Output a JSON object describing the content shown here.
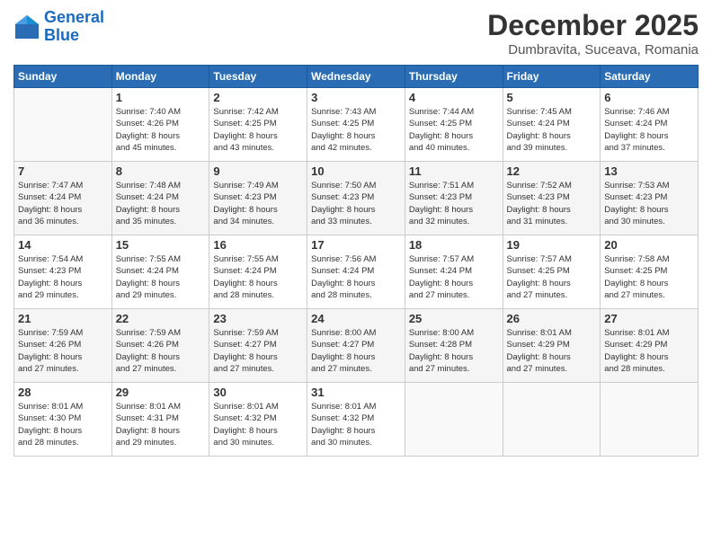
{
  "header": {
    "logo_line1": "General",
    "logo_line2": "Blue",
    "month": "December 2025",
    "location": "Dumbravita, Suceava, Romania"
  },
  "weekdays": [
    "Sunday",
    "Monday",
    "Tuesday",
    "Wednesday",
    "Thursday",
    "Friday",
    "Saturday"
  ],
  "weeks": [
    [
      {
        "day": "",
        "info": ""
      },
      {
        "day": "1",
        "info": "Sunrise: 7:40 AM\nSunset: 4:26 PM\nDaylight: 8 hours\nand 45 minutes."
      },
      {
        "day": "2",
        "info": "Sunrise: 7:42 AM\nSunset: 4:25 PM\nDaylight: 8 hours\nand 43 minutes."
      },
      {
        "day": "3",
        "info": "Sunrise: 7:43 AM\nSunset: 4:25 PM\nDaylight: 8 hours\nand 42 minutes."
      },
      {
        "day": "4",
        "info": "Sunrise: 7:44 AM\nSunset: 4:25 PM\nDaylight: 8 hours\nand 40 minutes."
      },
      {
        "day": "5",
        "info": "Sunrise: 7:45 AM\nSunset: 4:24 PM\nDaylight: 8 hours\nand 39 minutes."
      },
      {
        "day": "6",
        "info": "Sunrise: 7:46 AM\nSunset: 4:24 PM\nDaylight: 8 hours\nand 37 minutes."
      }
    ],
    [
      {
        "day": "7",
        "info": "Sunrise: 7:47 AM\nSunset: 4:24 PM\nDaylight: 8 hours\nand 36 minutes."
      },
      {
        "day": "8",
        "info": "Sunrise: 7:48 AM\nSunset: 4:24 PM\nDaylight: 8 hours\nand 35 minutes."
      },
      {
        "day": "9",
        "info": "Sunrise: 7:49 AM\nSunset: 4:23 PM\nDaylight: 8 hours\nand 34 minutes."
      },
      {
        "day": "10",
        "info": "Sunrise: 7:50 AM\nSunset: 4:23 PM\nDaylight: 8 hours\nand 33 minutes."
      },
      {
        "day": "11",
        "info": "Sunrise: 7:51 AM\nSunset: 4:23 PM\nDaylight: 8 hours\nand 32 minutes."
      },
      {
        "day": "12",
        "info": "Sunrise: 7:52 AM\nSunset: 4:23 PM\nDaylight: 8 hours\nand 31 minutes."
      },
      {
        "day": "13",
        "info": "Sunrise: 7:53 AM\nSunset: 4:23 PM\nDaylight: 8 hours\nand 30 minutes."
      }
    ],
    [
      {
        "day": "14",
        "info": "Sunrise: 7:54 AM\nSunset: 4:23 PM\nDaylight: 8 hours\nand 29 minutes."
      },
      {
        "day": "15",
        "info": "Sunrise: 7:55 AM\nSunset: 4:24 PM\nDaylight: 8 hours\nand 29 minutes."
      },
      {
        "day": "16",
        "info": "Sunrise: 7:55 AM\nSunset: 4:24 PM\nDaylight: 8 hours\nand 28 minutes."
      },
      {
        "day": "17",
        "info": "Sunrise: 7:56 AM\nSunset: 4:24 PM\nDaylight: 8 hours\nand 28 minutes."
      },
      {
        "day": "18",
        "info": "Sunrise: 7:57 AM\nSunset: 4:24 PM\nDaylight: 8 hours\nand 27 minutes."
      },
      {
        "day": "19",
        "info": "Sunrise: 7:57 AM\nSunset: 4:25 PM\nDaylight: 8 hours\nand 27 minutes."
      },
      {
        "day": "20",
        "info": "Sunrise: 7:58 AM\nSunset: 4:25 PM\nDaylight: 8 hours\nand 27 minutes."
      }
    ],
    [
      {
        "day": "21",
        "info": "Sunrise: 7:59 AM\nSunset: 4:26 PM\nDaylight: 8 hours\nand 27 minutes."
      },
      {
        "day": "22",
        "info": "Sunrise: 7:59 AM\nSunset: 4:26 PM\nDaylight: 8 hours\nand 27 minutes."
      },
      {
        "day": "23",
        "info": "Sunrise: 7:59 AM\nSunset: 4:27 PM\nDaylight: 8 hours\nand 27 minutes."
      },
      {
        "day": "24",
        "info": "Sunrise: 8:00 AM\nSunset: 4:27 PM\nDaylight: 8 hours\nand 27 minutes."
      },
      {
        "day": "25",
        "info": "Sunrise: 8:00 AM\nSunset: 4:28 PM\nDaylight: 8 hours\nand 27 minutes."
      },
      {
        "day": "26",
        "info": "Sunrise: 8:01 AM\nSunset: 4:29 PM\nDaylight: 8 hours\nand 27 minutes."
      },
      {
        "day": "27",
        "info": "Sunrise: 8:01 AM\nSunset: 4:29 PM\nDaylight: 8 hours\nand 28 minutes."
      }
    ],
    [
      {
        "day": "28",
        "info": "Sunrise: 8:01 AM\nSunset: 4:30 PM\nDaylight: 8 hours\nand 28 minutes."
      },
      {
        "day": "29",
        "info": "Sunrise: 8:01 AM\nSunset: 4:31 PM\nDaylight: 8 hours\nand 29 minutes."
      },
      {
        "day": "30",
        "info": "Sunrise: 8:01 AM\nSunset: 4:32 PM\nDaylight: 8 hours\nand 30 minutes."
      },
      {
        "day": "31",
        "info": "Sunrise: 8:01 AM\nSunset: 4:32 PM\nDaylight: 8 hours\nand 30 minutes."
      },
      {
        "day": "",
        "info": ""
      },
      {
        "day": "",
        "info": ""
      },
      {
        "day": "",
        "info": ""
      }
    ]
  ]
}
